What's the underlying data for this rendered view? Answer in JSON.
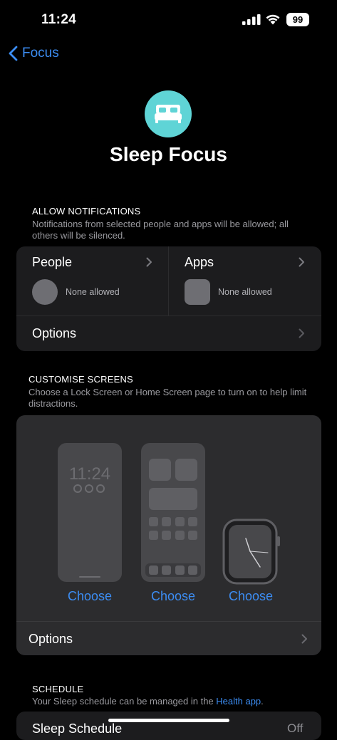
{
  "status": {
    "time": "11:24",
    "battery": "99"
  },
  "nav": {
    "back_label": "Focus"
  },
  "title": "Sleep Focus",
  "allow": {
    "header": "ALLOW NOTIFICATIONS",
    "subtitle": "Notifications from selected people and apps will be allowed; all others will be silenced.",
    "people_label": "People",
    "people_value": "None allowed",
    "apps_label": "Apps",
    "apps_value": "None allowed",
    "options_label": "Options"
  },
  "customise": {
    "header": "CUSTOMISE SCREENS",
    "subtitle": "Choose a Lock Screen or Home Screen page to turn on to help limit distractions.",
    "lock_time": "11:24",
    "choose_lock": "Choose",
    "choose_home": "Choose",
    "choose_watch": "Choose",
    "options_label": "Options"
  },
  "schedule": {
    "header": "SCHEDULE",
    "subtitle_prefix": "Your Sleep schedule can be managed in the ",
    "subtitle_link": "Health app",
    "subtitle_suffix": ".",
    "row_label": "Sleep Schedule",
    "row_value": "Off"
  },
  "colors": {
    "accent": "#3c8df3",
    "focus_teal": "#5fd4d6",
    "card": "#1c1c1e"
  }
}
